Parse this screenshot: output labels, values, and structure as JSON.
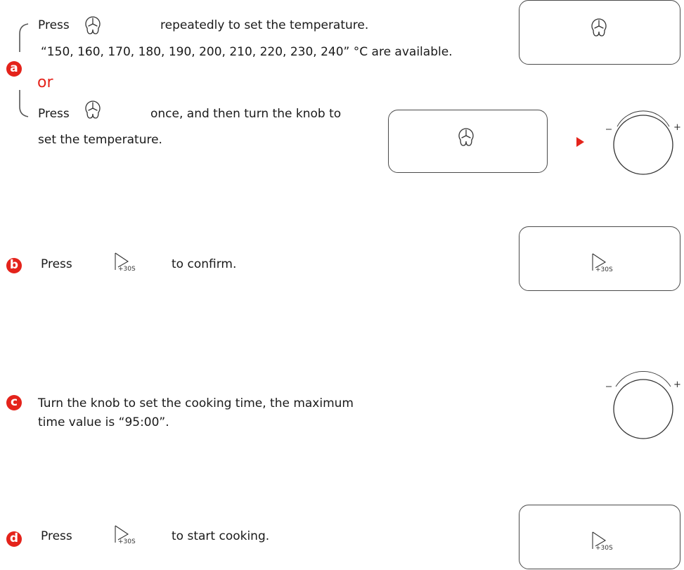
{
  "colors": {
    "accent": "#e4231b",
    "line": "#3a3a3a"
  },
  "step_a": {
    "badge": "a",
    "line1_press": "Press",
    "line1_rest": "repeatedly to set the temperature.",
    "line2": "“150, 160, 170, 180, 190, 200, 210, 220, 230, 240” °C are available.",
    "or": "or",
    "line3_press": "Press",
    "line3_rest": "once, and then turn the knob to",
    "line4": "set the temperature.",
    "icon": "temperature-thermometer-icon"
  },
  "step_b": {
    "badge": "b",
    "press": "Press",
    "rest": "to confirm.",
    "icon_label": "+30S",
    "icon": "start-play-icon"
  },
  "step_c": {
    "badge": "c",
    "line1": "Turn the knob to set the cooking time, the maximum",
    "line2": "time value is “95:00”."
  },
  "step_d": {
    "badge": "d",
    "press": "Press",
    "rest": "to start cooking.",
    "icon_label": "+30S",
    "icon": "start-play-icon"
  },
  "knob": {
    "minus": "−",
    "plus": "+"
  }
}
